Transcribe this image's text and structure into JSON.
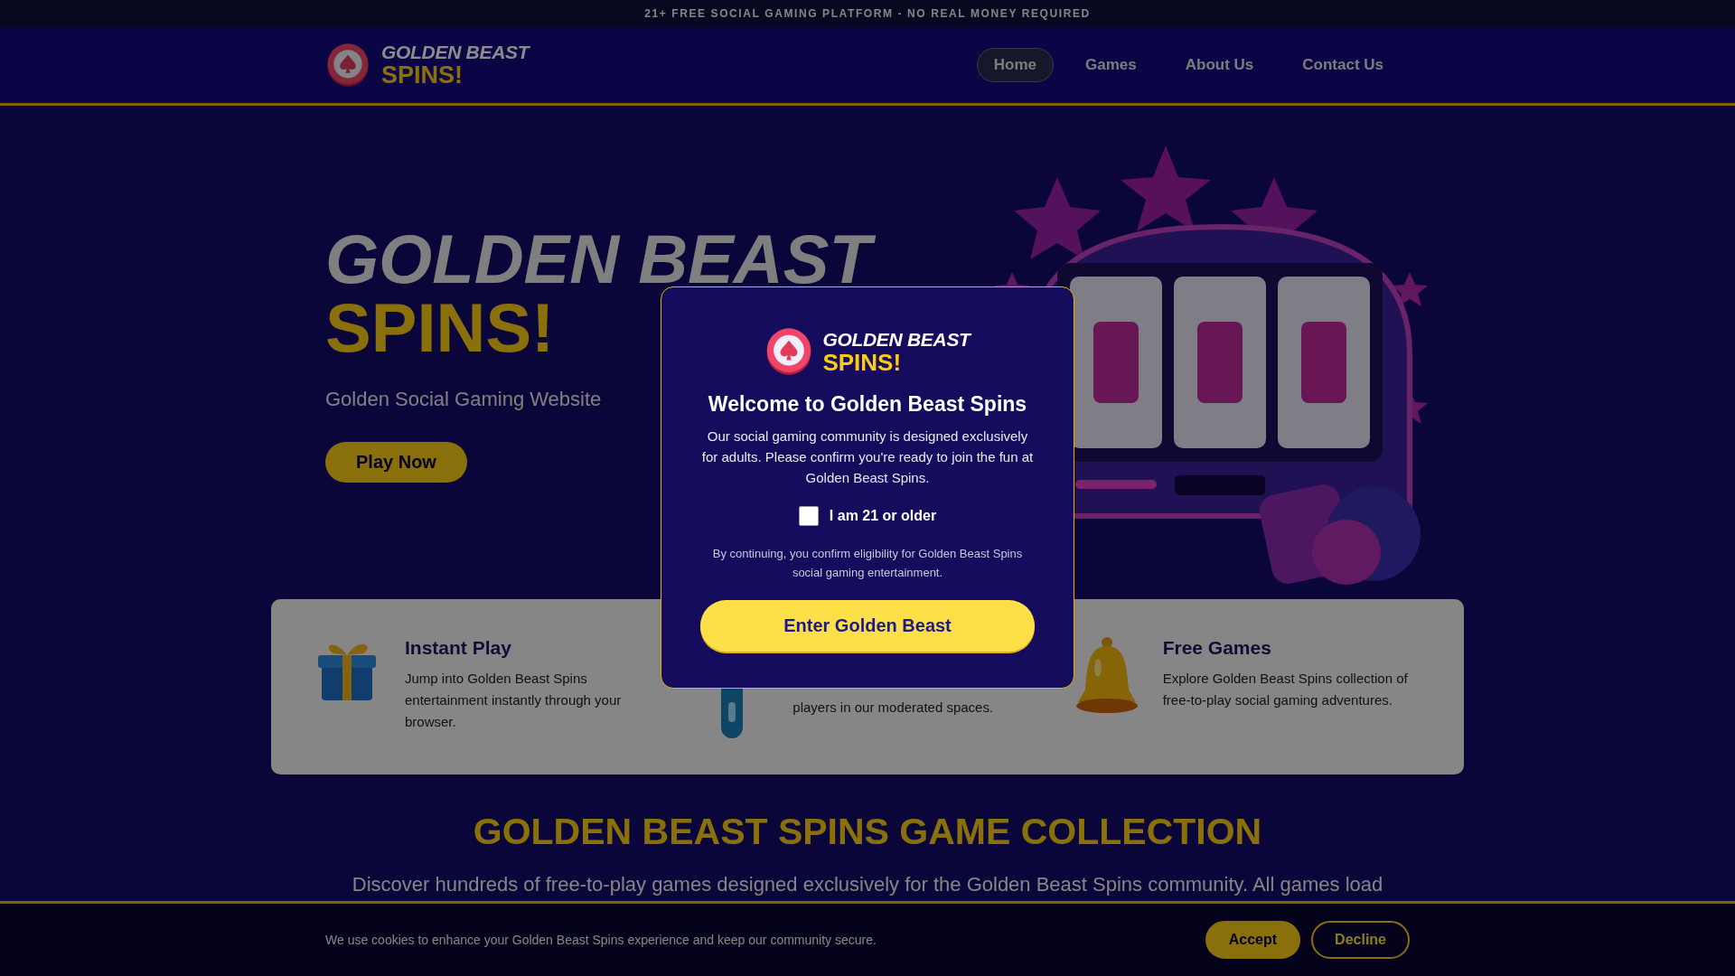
{
  "top_banner": {
    "text": "21+ FREE SOCIAL GAMING PLATFORM - NO REAL MONEY REQUIRED"
  },
  "header": {
    "logo": {
      "line1": "GOLDEN BEAST",
      "line2": "SPINS!"
    },
    "nav": [
      {
        "label": "Home",
        "selected": true
      },
      {
        "label": "Games",
        "selected": false
      },
      {
        "label": "About Us",
        "selected": false
      },
      {
        "label": "Contact Us",
        "selected": false
      }
    ]
  },
  "hero": {
    "title_line1": "GOLDEN BEAST",
    "title_line2": "SPINS!",
    "subtitle": "Golden Social Gaming Website",
    "button": "Play Now"
  },
  "features": [
    {
      "kind": "gift",
      "title": "Instant Play",
      "description": "Jump into Golden Beast Spins entertainment instantly through your browser."
    },
    {
      "kind": "figure",
      "description": "players in our moderated spaces."
    },
    {
      "kind": "bell",
      "title": "Free Games",
      "description": "Explore Golden Beast Spins collection of free-to-play social gaming adventures."
    }
  ],
  "collection": {
    "heading": "GOLDEN BEAST SPINS GAME COLLECTION",
    "intro": "Discover hundreds of free-to-play games designed exclusively for the Golden Beast Spins community. All games load"
  },
  "cookie_bar": {
    "text": "We use cookies to enhance your Golden Beast Spins experience and keep our community secure.",
    "buttons": [
      {
        "label": "Accept",
        "kind": "primary"
      },
      {
        "label": "Decline",
        "kind": "outline"
      }
    ]
  },
  "age_modal": {
    "logo": {
      "line1": "GOLDEN BEAST",
      "line2": "SPINS!"
    },
    "title": "Welcome to Golden Beast Spins",
    "message": "Our social gaming community is designed exclusively for adults. Please confirm you're ready to join the fun at Golden Beast Spins.",
    "checkbox": {
      "label": "I am 21 or older",
      "checked": false
    },
    "notice": "By continuing, you confirm eligibility for Golden Beast Spins social gaming entertainment.",
    "button": "Enter Golden Beast"
  }
}
